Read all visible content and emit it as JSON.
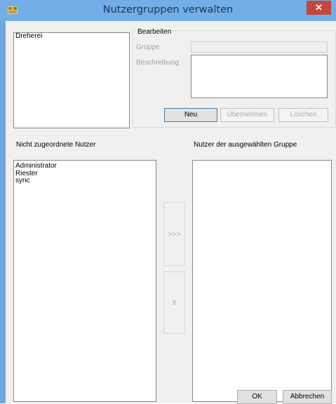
{
  "window": {
    "title": "Nutzergruppen verwalten",
    "close_glyph": "✕"
  },
  "groups": {
    "items": [
      "Dreherei"
    ]
  },
  "edit": {
    "legend": "Bearbeiten",
    "group_label": "Gruppe",
    "group_value": "",
    "description_label": "Beschreibung",
    "description_value": "",
    "new_button": "Neu",
    "apply_button": "Übernehmen",
    "delete_button": "Löschen"
  },
  "unassigned": {
    "label": "Nicht zugeordnete Nutzer",
    "items": [
      "Administrator",
      "Riester",
      "sync"
    ]
  },
  "assigned": {
    "label": "Nutzer der ausgewählten Gruppe",
    "items": []
  },
  "transfer": {
    "add_label": ">>>",
    "remove_label": "X"
  },
  "footer": {
    "ok_button": "OK",
    "cancel_button": "Abbrechen"
  },
  "colors": {
    "titlebar": "#73aee8",
    "frame": "#6fa6df",
    "close": "#c7453b"
  }
}
